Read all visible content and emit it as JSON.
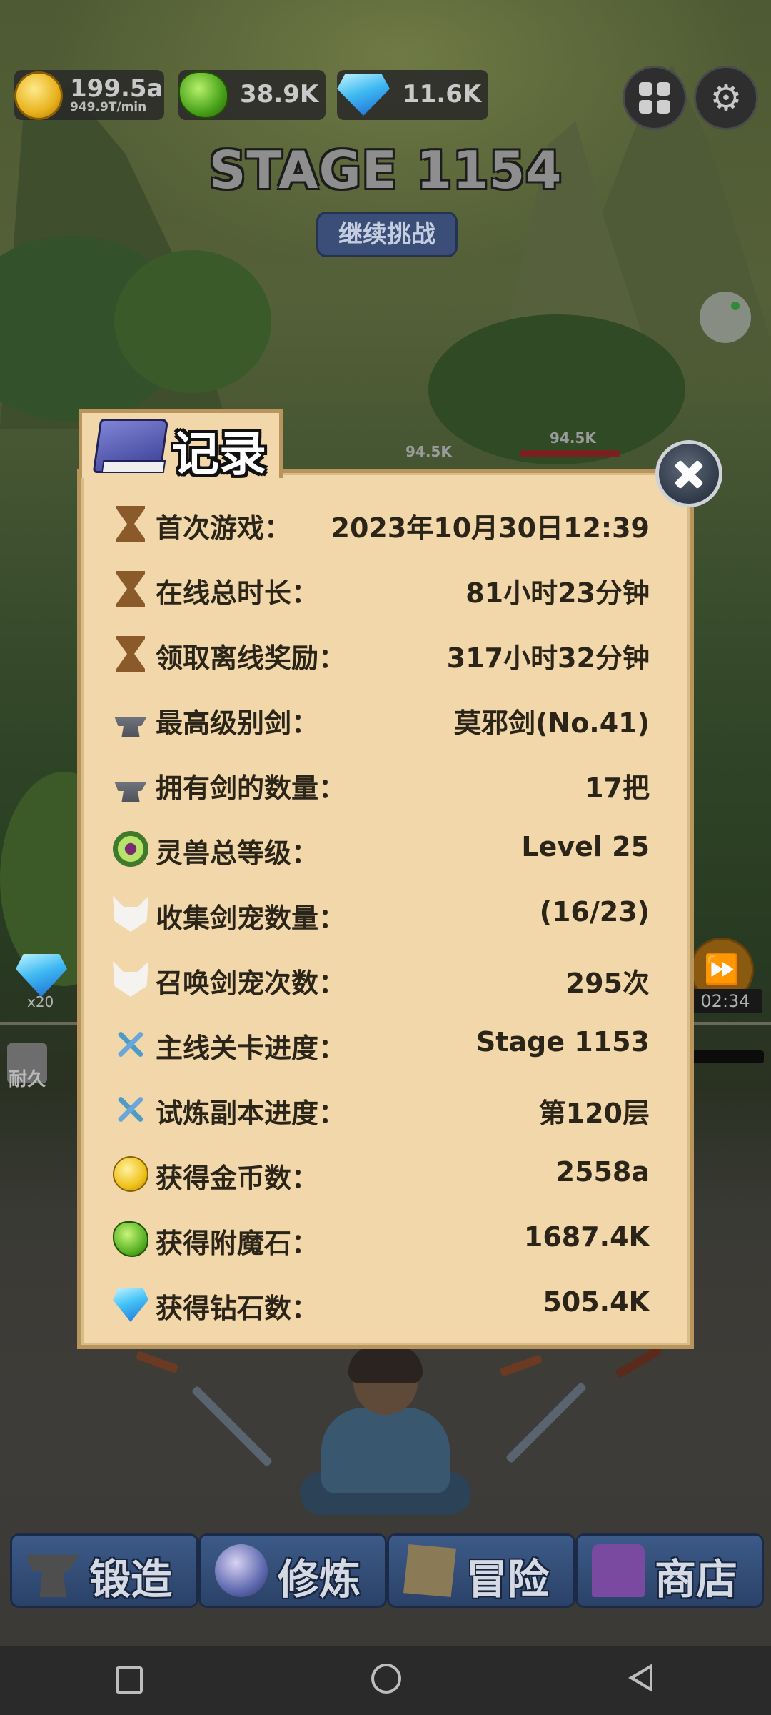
{
  "hud": {
    "gold_value": "199.5a",
    "gold_rate": "949.9T/min",
    "stone_value": "38.9K",
    "diamond_value": "11.6K"
  },
  "stage": {
    "title": "STAGE 1154",
    "continue_label": "继续挑战"
  },
  "enemies": [
    {
      "hp": "94.5K"
    },
    {
      "hp": "94.5K"
    }
  ],
  "side": {
    "diamond_count": "x20",
    "endurance_label": "耐久",
    "timer": "02:34"
  },
  "dialog": {
    "title": "记录",
    "rows": [
      {
        "icon": "hourglass-icon",
        "label": "首次游戏：",
        "value": "2023年10月30日12:39"
      },
      {
        "icon": "hourglass-icon",
        "label": "在线总时长：",
        "value": "81小时23分钟"
      },
      {
        "icon": "hourglass-icon",
        "label": "领取离线奖励：",
        "value": "317小时32分钟"
      },
      {
        "icon": "anvil-sword-icon",
        "label": "最高级别剑：",
        "value": "莫邪剑(No.41)"
      },
      {
        "icon": "anvil-sword-icon",
        "label": "拥有剑的数量：",
        "value": "17把"
      },
      {
        "icon": "spirit-orb-icon",
        "label": "灵兽总等级：",
        "value": "Level 25"
      },
      {
        "icon": "fox-mask-icon",
        "label": "收集剑宠数量：",
        "value": "(16/23)"
      },
      {
        "icon": "fox-mask-icon",
        "label": "召唤剑宠次数：",
        "value": "295次"
      },
      {
        "icon": "crossed-swords-icon",
        "label": "主线关卡进度：",
        "value": "Stage 1153"
      },
      {
        "icon": "crossed-swords-icon",
        "label": "试炼副本进度：",
        "value": "第120层"
      },
      {
        "icon": "gold-coin-icon",
        "label": "获得金币数：",
        "value": "2558a"
      },
      {
        "icon": "enchant-stone-icon",
        "label": "获得附魔石：",
        "value": "1687.4K"
      },
      {
        "icon": "diamond-icon",
        "label": "获得钻石数：",
        "value": "505.4K"
      }
    ]
  },
  "bottom_nav": [
    {
      "label": "锻造",
      "icon": "anvil-icon"
    },
    {
      "label": "修炼",
      "icon": "orb-icon"
    },
    {
      "label": "冒险",
      "icon": "map-scroll-icon"
    },
    {
      "label": "商店",
      "icon": "treasure-chest-icon"
    }
  ],
  "colors": {
    "panel_bg": "#f1d7a9",
    "panel_border": "#b9945c",
    "text_dark": "#2b2419",
    "nav_blue": "#2b4268"
  }
}
